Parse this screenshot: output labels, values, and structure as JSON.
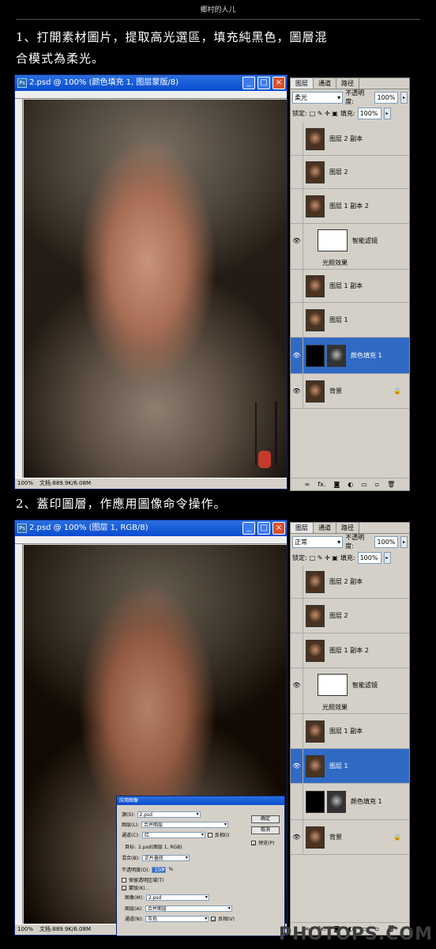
{
  "header": {
    "title": "郷村的人儿"
  },
  "steps": [
    {
      "line1": "1、打開素材圖片，提取高光選區，填充純黑色，圖層混",
      "line2": "合模式為柔光。"
    },
    {
      "line1": "2、蓋印圖層，作應用圖像命令操作。"
    }
  ],
  "window1": {
    "title": "2.psd @ 100% (颜色填充 1, 图层蒙版/8)",
    "zoom": "100%",
    "doc": "文档:889.9K/6.08M"
  },
  "window2": {
    "title": "2.psd @ 100% (图层 1, RGB/8)",
    "zoom": "100%",
    "doc": "文档:889.9K/6.08M"
  },
  "panel_tabs": [
    "图层",
    "通道",
    "路径"
  ],
  "panel1": {
    "blend": "柔光",
    "opacity_label": "不透明度:",
    "opacity": "100%",
    "lock_label": "锁定:",
    "fill_label": "填充:",
    "fill": "100%",
    "layers": [
      "图层 2 副本",
      "图层 2",
      "图层 1 副本 2",
      "智能滤镜",
      "光照效果",
      "图层 1 副本",
      "图层 1",
      "颜色填充 1",
      "背景"
    ]
  },
  "panel2": {
    "blend": "正常",
    "opacity_label": "不透明度:",
    "opacity": "100%",
    "lock_label": "锁定:",
    "fill_label": "填充:",
    "fill": "100%",
    "layers": [
      "图层 2 副本",
      "图层 2",
      "图层 1 副本 2",
      "智能滤镜",
      "光照效果",
      "图层 1 副本",
      "图层 1",
      "颜色填充 1",
      "背景"
    ]
  },
  "dialog": {
    "title": "应用图像",
    "source_label": "源(S):",
    "source": "2.psd",
    "layer_label": "图层(L):",
    "layer": "合并图层",
    "channel_label": "通道(C):",
    "channel": "红",
    "invert_label": "反相(I)",
    "target_label": "目标:",
    "target": "2.psd(图层 1, RGB)",
    "blend_label": "混合(B):",
    "blend": "正片叠底",
    "opacity_label": "不透明度(O):",
    "opacity": "100",
    "percent": "%",
    "preserve_label": "保留透明区域(T)",
    "mask_label": "蒙版(K)...",
    "image_label": "图像(M):",
    "image": "2.psd",
    "layer2_label": "图层(A):",
    "layer2": "合并图层",
    "channel2_label": "通道(N):",
    "channel2": "灰色",
    "invert2_label": "反相(V)",
    "ok": "确定",
    "cancel": "取消",
    "preview": "预览(P)"
  },
  "watermark": "PHOTOPS.COM"
}
